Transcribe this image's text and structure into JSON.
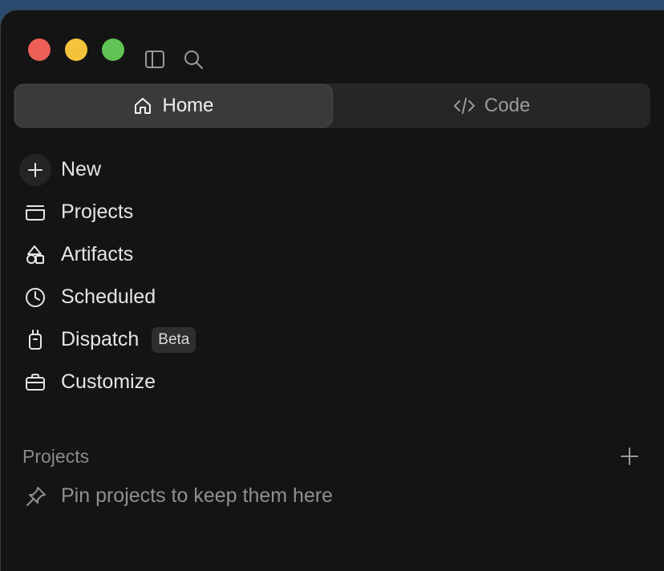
{
  "titlebar": {
    "icons": [
      "sidebar-toggle-icon",
      "search-icon"
    ],
    "traffic_light_colors": {
      "close": "#ed5f57",
      "minimize": "#f5c33b",
      "maximize": "#5fc454"
    }
  },
  "mode_switcher": {
    "tabs": [
      {
        "label": "Home",
        "icon": "home-icon",
        "active": true
      },
      {
        "label": "Code",
        "icon": "code-icon",
        "active": false
      }
    ]
  },
  "nav": {
    "items": [
      {
        "label": "New",
        "icon": "plus-icon"
      },
      {
        "label": "Projects",
        "icon": "folder-icon"
      },
      {
        "label": "Artifacts",
        "icon": "shapes-icon"
      },
      {
        "label": "Scheduled",
        "icon": "clock-icon"
      },
      {
        "label": "Dispatch",
        "icon": "device-icon",
        "badge": "Beta"
      },
      {
        "label": "Customize",
        "icon": "briefcase-icon"
      }
    ]
  },
  "projects_section": {
    "title": "Projects",
    "add_icon": "plus-icon",
    "empty_text": "Pin projects to keep them here",
    "empty_icon": "pin-icon"
  },
  "colors": {
    "window_bg": "#141414",
    "segment_bg": "#262626",
    "segment_active_bg": "#3a3a3a",
    "text_primary": "#e6e6e6",
    "text_muted": "#8a8a8a"
  }
}
